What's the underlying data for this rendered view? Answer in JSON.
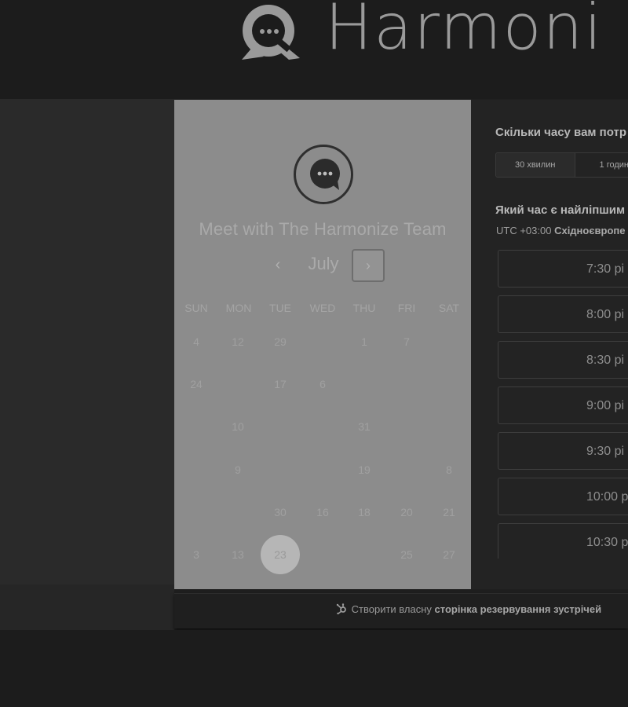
{
  "header": {
    "brand_text": "Harmoni"
  },
  "scheduler": {
    "title": "Meet with The Harmonize Team",
    "month": "July",
    "prev_icon": "‹",
    "next_icon": "›",
    "weekdays": [
      "SUN",
      "MON",
      "TUE",
      "WED",
      "THU",
      "FRI",
      "SAT"
    ],
    "days": [
      {
        "label": "4",
        "col": 0,
        "row": 0
      },
      {
        "label": "12",
        "col": 1,
        "row": 0
      },
      {
        "label": "29",
        "col": 2,
        "row": 0
      },
      {
        "label": "1",
        "col": 4,
        "row": 0
      },
      {
        "label": "7",
        "col": 5,
        "row": 0
      },
      {
        "label": "24",
        "col": 0,
        "row": 1
      },
      {
        "label": "17",
        "col": 2,
        "row": 1
      },
      {
        "label": "6",
        "col": 3,
        "row": 1
      },
      {
        "label": "10",
        "col": 1,
        "row": 2
      },
      {
        "label": "31",
        "col": 4,
        "row": 2
      },
      {
        "label": "9",
        "col": 1,
        "row": 3
      },
      {
        "label": "19",
        "col": 4,
        "row": 3
      },
      {
        "label": "8",
        "col": 6,
        "row": 3
      },
      {
        "label": "30",
        "col": 2,
        "row": 4
      },
      {
        "label": "16",
        "col": 3,
        "row": 4
      },
      {
        "label": "18",
        "col": 4,
        "row": 4
      },
      {
        "label": "20",
        "col": 5,
        "row": 4
      },
      {
        "label": "21",
        "col": 6,
        "row": 4
      },
      {
        "label": "3",
        "col": 0,
        "row": 5
      },
      {
        "label": "13",
        "col": 1,
        "row": 5
      },
      {
        "label": "23",
        "col": 2,
        "row": 5,
        "selected": true
      },
      {
        "label": "25",
        "col": 5,
        "row": 5
      },
      {
        "label": "27",
        "col": 6,
        "row": 5
      }
    ]
  },
  "booking": {
    "duration_question": "Скільки часу вам потр",
    "durations": [
      "30 хвилин",
      "1 годин"
    ],
    "time_question": "Який час є найліпшим",
    "timezone_prefix": "UTC +03:00",
    "timezone_name": "Східноєвропе",
    "slots": [
      "7:30 pi",
      "8:00 pi",
      "8:30 pi",
      "9:00 pi",
      "9:30 pi",
      "10:00 p",
      "10:30 p"
    ]
  },
  "footer": {
    "text_plain": "Створити власну",
    "text_bold": "сторінка резервування зустрічей"
  },
  "colors": {
    "calendar_panel": "#8c8c8c",
    "selected_day": "#b6b6b6",
    "background": "#1f1f1f"
  }
}
